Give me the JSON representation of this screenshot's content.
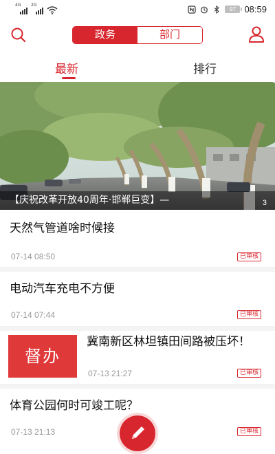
{
  "status_bar": {
    "net1": "4G",
    "net2": "2G",
    "battery": "97",
    "time": "08:59",
    "icons": [
      "nfc-icon",
      "alarm-icon",
      "bluetooth-icon",
      "battery-icon"
    ]
  },
  "header": {
    "segments": [
      "政务",
      "部门"
    ],
    "selected_segment": "政务",
    "accent_color": "#d8262e"
  },
  "tabs": {
    "latest": "最新",
    "rank": "排行"
  },
  "banner": {
    "caption": "【庆祝改革开放40周年·邯郸巨变】—",
    "pager": "3"
  },
  "items": [
    {
      "title": "天然气管道啥时候接",
      "time": "07-14 08:50",
      "badge": "已审核"
    },
    {
      "title": "电动汽车充电不方便",
      "time": "07-14 07:44",
      "badge": "已审核"
    },
    {
      "tag": "督办",
      "title": "冀南新区林坦镇田间路被压坏！",
      "time": "07-13 21:27",
      "badge": "已审核"
    },
    {
      "title": "体育公园何时可竣工呢？",
      "time": "07-13 21:13",
      "badge": "已审核"
    }
  ]
}
